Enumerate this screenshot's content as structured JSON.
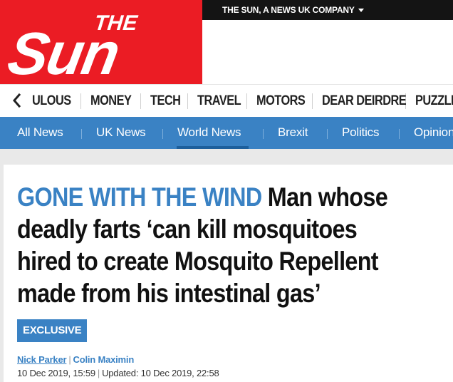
{
  "topbar": {
    "company_label": "THE SUN, A NEWS UK COMPANY",
    "caret_icon": "caret-down-icon"
  },
  "logo": {
    "text_top": "THE",
    "text_main": "Sun",
    "background_color": "#eb1c24"
  },
  "section_nav": {
    "scroll_left_icon": "chevron-left-icon",
    "items": [
      {
        "label": "ULOUS"
      },
      {
        "label": "MONEY"
      },
      {
        "label": "TECH"
      },
      {
        "label": "TRAVEL"
      },
      {
        "label": "MOTORS"
      },
      {
        "label": "DEAR DEIRDRE"
      },
      {
        "label": "PUZZLES"
      }
    ]
  },
  "sub_nav": {
    "background_color": "#3a82c4",
    "items": [
      {
        "label": "All News"
      },
      {
        "label": "UK News"
      },
      {
        "label": "World News",
        "active": true
      },
      {
        "label": "Brexit"
      },
      {
        "label": "Politics"
      },
      {
        "label": "Opinion"
      }
    ]
  },
  "article": {
    "kicker": "GONE WITH THE WIND",
    "headline": "Man whose deadly farts ‘can kill mosquitoes hired to create Mosquito Repellent made from his intestinal gas’",
    "badge": "EXCLUSIVE",
    "authors": [
      "Nick Parker",
      "Colin Maximin"
    ],
    "published": "10 Dec 2019, 15:59",
    "updated": "Updated: 10 Dec 2019, 22:58",
    "accent_color": "#3a82c4"
  }
}
